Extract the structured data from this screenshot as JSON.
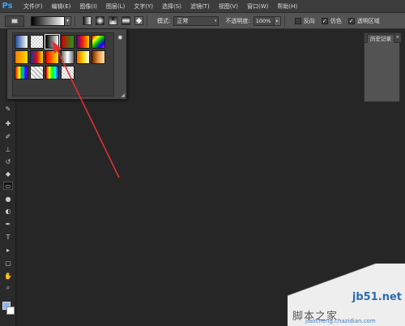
{
  "app": {
    "logo": "Ps"
  },
  "menu": [
    "文件(F)",
    "编辑(E)",
    "图像(I)",
    "图层(L)",
    "文字(Y)",
    "选择(S)",
    "滤镜(T)",
    "视图(V)",
    "窗口(W)",
    "帮助(H)"
  ],
  "options": {
    "mode_label": "模式:",
    "mode_value": "正常",
    "opacity_label": "不透明度:",
    "opacity_value": "100%",
    "reverse_label": "反向",
    "dither_label": "仿色",
    "transparency_label": "透明区域",
    "reverse_checked": false,
    "dither_checked": true,
    "transparency_checked": true
  },
  "history": {
    "tab_label": "历史记录"
  },
  "colors": {
    "foreground": "#8fb4ea",
    "background": "#ffffff"
  },
  "watermark": {
    "site": "jb51.net",
    "title": "脚本之家",
    "domain": "jiaocheng.chazidian.com"
  },
  "gradients": [
    "linear-gradient(to right, #1a4a9a, #ffffff)",
    "repeating-conic-gradient(#cfcfcf 0% 25%, #ffffff 0% 50%) 0 0/4px 4px",
    "linear-gradient(to right, #000000, #ffffff)",
    "linear-gradient(to right, #d40000, #1f9a1f)",
    "linear-gradient(to right, #5a0090, #ff2200, #ffd400)",
    "linear-gradient(135deg, #ff0000, #ffff00, #00c000, #0000ff, #ff00ff)",
    "linear-gradient(to right, #ff7a00, #ffe000)",
    "linear-gradient(to right, #1b2fa8, #d01010, #ffe000)",
    "linear-gradient(to right, #ff0000, #ffea00)",
    "linear-gradient(to right, #6b6b6b, #ffffff, #6b6b6b)",
    "linear-gradient(to right, #ff5a00, #ffd800, #ffffff)",
    "linear-gradient(to right, #7a2a00, #e59a40, #ffe6b0)",
    "linear-gradient(to right, #ff0000, #ff8800, #ffff00, #00c000, #00b0ff, #0000ff, #a000ff)",
    "repeating-linear-gradient(45deg, #c0c0c0 0 2px, #ffffff 2px 4px)",
    "linear-gradient(to right, #ff0000, #ffff00, #00ff00, #00ffff, #0000ff)",
    "repeating-conic-gradient(#cfcfcf 0% 25%, #ffffff 0% 50%) 0 0/4px 4px"
  ]
}
